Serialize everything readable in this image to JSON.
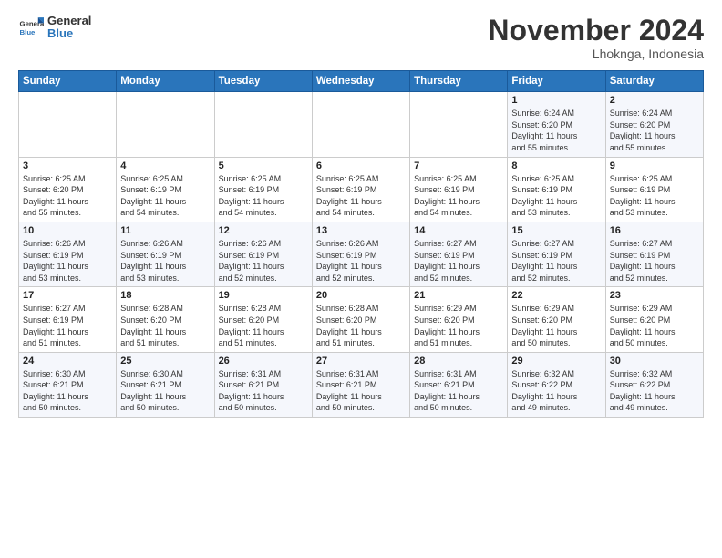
{
  "header": {
    "logo_line1": "General",
    "logo_line2": "Blue",
    "month": "November 2024",
    "location": "Lhoknga, Indonesia"
  },
  "weekdays": [
    "Sunday",
    "Monday",
    "Tuesday",
    "Wednesday",
    "Thursday",
    "Friday",
    "Saturday"
  ],
  "weeks": [
    [
      {
        "day": "",
        "info": ""
      },
      {
        "day": "",
        "info": ""
      },
      {
        "day": "",
        "info": ""
      },
      {
        "day": "",
        "info": ""
      },
      {
        "day": "",
        "info": ""
      },
      {
        "day": "1",
        "info": "Sunrise: 6:24 AM\nSunset: 6:20 PM\nDaylight: 11 hours\nand 55 minutes."
      },
      {
        "day": "2",
        "info": "Sunrise: 6:24 AM\nSunset: 6:20 PM\nDaylight: 11 hours\nand 55 minutes."
      }
    ],
    [
      {
        "day": "3",
        "info": "Sunrise: 6:25 AM\nSunset: 6:20 PM\nDaylight: 11 hours\nand 55 minutes."
      },
      {
        "day": "4",
        "info": "Sunrise: 6:25 AM\nSunset: 6:19 PM\nDaylight: 11 hours\nand 54 minutes."
      },
      {
        "day": "5",
        "info": "Sunrise: 6:25 AM\nSunset: 6:19 PM\nDaylight: 11 hours\nand 54 minutes."
      },
      {
        "day": "6",
        "info": "Sunrise: 6:25 AM\nSunset: 6:19 PM\nDaylight: 11 hours\nand 54 minutes."
      },
      {
        "day": "7",
        "info": "Sunrise: 6:25 AM\nSunset: 6:19 PM\nDaylight: 11 hours\nand 54 minutes."
      },
      {
        "day": "8",
        "info": "Sunrise: 6:25 AM\nSunset: 6:19 PM\nDaylight: 11 hours\nand 53 minutes."
      },
      {
        "day": "9",
        "info": "Sunrise: 6:25 AM\nSunset: 6:19 PM\nDaylight: 11 hours\nand 53 minutes."
      }
    ],
    [
      {
        "day": "10",
        "info": "Sunrise: 6:26 AM\nSunset: 6:19 PM\nDaylight: 11 hours\nand 53 minutes."
      },
      {
        "day": "11",
        "info": "Sunrise: 6:26 AM\nSunset: 6:19 PM\nDaylight: 11 hours\nand 53 minutes."
      },
      {
        "day": "12",
        "info": "Sunrise: 6:26 AM\nSunset: 6:19 PM\nDaylight: 11 hours\nand 52 minutes."
      },
      {
        "day": "13",
        "info": "Sunrise: 6:26 AM\nSunset: 6:19 PM\nDaylight: 11 hours\nand 52 minutes."
      },
      {
        "day": "14",
        "info": "Sunrise: 6:27 AM\nSunset: 6:19 PM\nDaylight: 11 hours\nand 52 minutes."
      },
      {
        "day": "15",
        "info": "Sunrise: 6:27 AM\nSunset: 6:19 PM\nDaylight: 11 hours\nand 52 minutes."
      },
      {
        "day": "16",
        "info": "Sunrise: 6:27 AM\nSunset: 6:19 PM\nDaylight: 11 hours\nand 52 minutes."
      }
    ],
    [
      {
        "day": "17",
        "info": "Sunrise: 6:27 AM\nSunset: 6:19 PM\nDaylight: 11 hours\nand 51 minutes."
      },
      {
        "day": "18",
        "info": "Sunrise: 6:28 AM\nSunset: 6:20 PM\nDaylight: 11 hours\nand 51 minutes."
      },
      {
        "day": "19",
        "info": "Sunrise: 6:28 AM\nSunset: 6:20 PM\nDaylight: 11 hours\nand 51 minutes."
      },
      {
        "day": "20",
        "info": "Sunrise: 6:28 AM\nSunset: 6:20 PM\nDaylight: 11 hours\nand 51 minutes."
      },
      {
        "day": "21",
        "info": "Sunrise: 6:29 AM\nSunset: 6:20 PM\nDaylight: 11 hours\nand 51 minutes."
      },
      {
        "day": "22",
        "info": "Sunrise: 6:29 AM\nSunset: 6:20 PM\nDaylight: 11 hours\nand 50 minutes."
      },
      {
        "day": "23",
        "info": "Sunrise: 6:29 AM\nSunset: 6:20 PM\nDaylight: 11 hours\nand 50 minutes."
      }
    ],
    [
      {
        "day": "24",
        "info": "Sunrise: 6:30 AM\nSunset: 6:21 PM\nDaylight: 11 hours\nand 50 minutes."
      },
      {
        "day": "25",
        "info": "Sunrise: 6:30 AM\nSunset: 6:21 PM\nDaylight: 11 hours\nand 50 minutes."
      },
      {
        "day": "26",
        "info": "Sunrise: 6:31 AM\nSunset: 6:21 PM\nDaylight: 11 hours\nand 50 minutes."
      },
      {
        "day": "27",
        "info": "Sunrise: 6:31 AM\nSunset: 6:21 PM\nDaylight: 11 hours\nand 50 minutes."
      },
      {
        "day": "28",
        "info": "Sunrise: 6:31 AM\nSunset: 6:21 PM\nDaylight: 11 hours\nand 50 minutes."
      },
      {
        "day": "29",
        "info": "Sunrise: 6:32 AM\nSunset: 6:22 PM\nDaylight: 11 hours\nand 49 minutes."
      },
      {
        "day": "30",
        "info": "Sunrise: 6:32 AM\nSunset: 6:22 PM\nDaylight: 11 hours\nand 49 minutes."
      }
    ]
  ]
}
